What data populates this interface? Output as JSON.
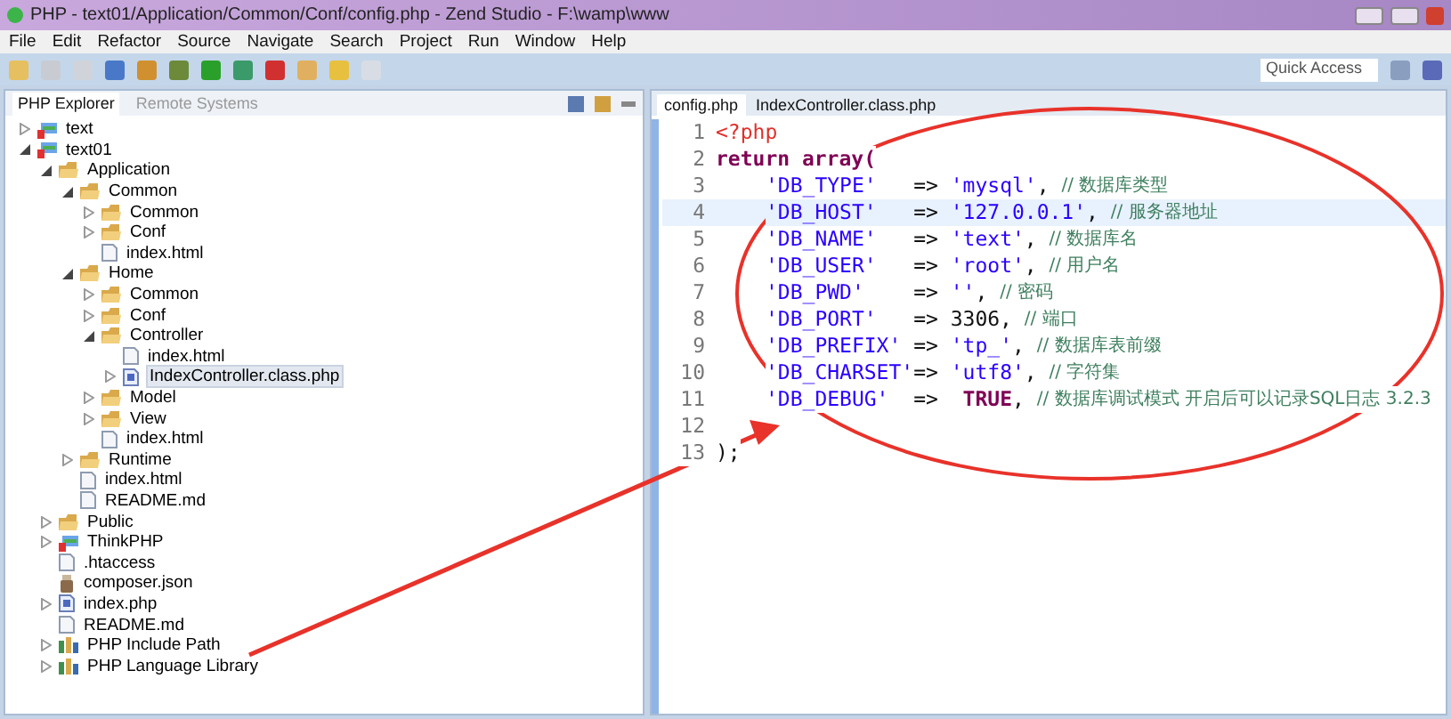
{
  "window": {
    "title": "PHP - text01/Application/Common/Conf/config.php - Zend Studio - F:\\wamp\\www"
  },
  "menu": [
    "File",
    "Edit",
    "Refactor",
    "Source",
    "Navigate",
    "Search",
    "Project",
    "Run",
    "Window",
    "Help"
  ],
  "quick_access": {
    "placeholder": "Quick Access"
  },
  "explorer": {
    "tabs": [
      {
        "label": "PHP Explorer",
        "selected": true
      },
      {
        "label": "Remote Systems",
        "selected": false
      }
    ],
    "tree": [
      {
        "label": "text",
        "kind": "project",
        "expanded": false,
        "selected": false
      },
      {
        "label": "text01",
        "kind": "project",
        "expanded": true,
        "selected": false,
        "children": [
          {
            "label": "Application",
            "kind": "folder",
            "expanded": true,
            "selected": false,
            "children": [
              {
                "label": "Common",
                "kind": "folder",
                "expanded": true,
                "selected": false,
                "children": [
                  {
                    "label": "Common",
                    "kind": "folder",
                    "expanded": false,
                    "selected": false
                  },
                  {
                    "label": "Conf",
                    "kind": "folder",
                    "expanded": false,
                    "selected": false
                  },
                  {
                    "label": "index.html",
                    "kind": "file",
                    "selected": false
                  }
                ]
              },
              {
                "label": "Home",
                "kind": "folder",
                "expanded": true,
                "selected": false,
                "children": [
                  {
                    "label": "Common",
                    "kind": "folder",
                    "expanded": false,
                    "selected": false
                  },
                  {
                    "label": "Conf",
                    "kind": "folder",
                    "expanded": false,
                    "selected": false
                  },
                  {
                    "label": "Controller",
                    "kind": "folder",
                    "expanded": true,
                    "selected": false,
                    "children": [
                      {
                        "label": "index.html",
                        "kind": "file",
                        "selected": false
                      },
                      {
                        "label": "IndexController.class.php",
                        "kind": "php",
                        "expanded": false,
                        "selected": true
                      }
                    ]
                  },
                  {
                    "label": "Model",
                    "kind": "folder",
                    "expanded": false,
                    "selected": false
                  },
                  {
                    "label": "View",
                    "kind": "folder",
                    "expanded": false,
                    "selected": false
                  },
                  {
                    "label": "index.html",
                    "kind": "file",
                    "selected": false
                  }
                ]
              },
              {
                "label": "Runtime",
                "kind": "folder",
                "expanded": false,
                "selected": false
              },
              {
                "label": "index.html",
                "kind": "file",
                "selected": false
              },
              {
                "label": "README.md",
                "kind": "file",
                "selected": false
              }
            ]
          },
          {
            "label": "Public",
            "kind": "folder",
            "expanded": false,
            "selected": false
          },
          {
            "label": "ThinkPHP",
            "kind": "project",
            "expanded": false,
            "selected": false
          },
          {
            "label": ".htaccess",
            "kind": "file",
            "selected": false
          },
          {
            "label": "composer.json",
            "kind": "json",
            "selected": false
          },
          {
            "label": "index.php",
            "kind": "php",
            "expanded": false,
            "selected": false
          },
          {
            "label": "README.md",
            "kind": "file",
            "selected": false
          },
          {
            "label": "PHP Include Path",
            "kind": "library",
            "expanded": false,
            "selected": false
          },
          {
            "label": "PHP Language Library",
            "kind": "library",
            "expanded": false,
            "selected": false
          }
        ]
      }
    ]
  },
  "editor": {
    "tabs": [
      {
        "label": "config.php",
        "selected": true
      },
      {
        "label": "IndexController.class.php",
        "selected": false
      }
    ],
    "lines": [
      {
        "number": "1",
        "current": false,
        "tokens": [
          {
            "kind": "tag",
            "text": "<?php"
          }
        ]
      },
      {
        "number": "2",
        "current": false,
        "tokens": [
          {
            "kind": "keyword",
            "text": "return array("
          }
        ]
      },
      {
        "number": "3",
        "current": false,
        "indented": true,
        "tokens": [
          {
            "kind": "string",
            "text": "'DB_TYPE'   "
          },
          {
            "kind": "plain",
            "text": "=> "
          },
          {
            "kind": "string",
            "text": "'mysql'"
          },
          {
            "kind": "plain",
            "text": ", "
          },
          {
            "kind": "comment",
            "text": "// 数据库类型"
          }
        ]
      },
      {
        "number": "4",
        "current": true,
        "indented": true,
        "tokens": [
          {
            "kind": "string",
            "text": "'DB_HOST'   "
          },
          {
            "kind": "plain",
            "text": "=> "
          },
          {
            "kind": "string",
            "text": "'127.0.0.1'"
          },
          {
            "kind": "plain",
            "text": ", "
          },
          {
            "kind": "comment",
            "text": "// 服务器地址"
          }
        ]
      },
      {
        "number": "5",
        "current": false,
        "indented": true,
        "tokens": [
          {
            "kind": "string",
            "text": "'DB_NAME'   "
          },
          {
            "kind": "plain",
            "text": "=> "
          },
          {
            "kind": "string",
            "text": "'text'"
          },
          {
            "kind": "plain",
            "text": ", "
          },
          {
            "kind": "comment",
            "text": "// 数据库名"
          }
        ]
      },
      {
        "number": "6",
        "current": false,
        "indented": true,
        "tokens": [
          {
            "kind": "string",
            "text": "'DB_USER'   "
          },
          {
            "kind": "plain",
            "text": "=> "
          },
          {
            "kind": "string",
            "text": "'root'"
          },
          {
            "kind": "plain",
            "text": ", "
          },
          {
            "kind": "comment",
            "text": "// 用户名"
          }
        ]
      },
      {
        "number": "7",
        "current": false,
        "indented": true,
        "tokens": [
          {
            "kind": "string",
            "text": "'DB_PWD'    "
          },
          {
            "kind": "plain",
            "text": "=> "
          },
          {
            "kind": "string",
            "text": "''"
          },
          {
            "kind": "plain",
            "text": ", "
          },
          {
            "kind": "comment",
            "text": "// 密码"
          }
        ]
      },
      {
        "number": "8",
        "current": false,
        "indented": true,
        "tokens": [
          {
            "kind": "string",
            "text": "'DB_PORT'   "
          },
          {
            "kind": "plain",
            "text": "=> 3306, "
          },
          {
            "kind": "comment",
            "text": "// 端口"
          }
        ]
      },
      {
        "number": "9",
        "current": false,
        "indented": true,
        "tokens": [
          {
            "kind": "string",
            "text": "'DB_PREFIX' "
          },
          {
            "kind": "plain",
            "text": "=> "
          },
          {
            "kind": "string",
            "text": "'tp_'"
          },
          {
            "kind": "plain",
            "text": ", "
          },
          {
            "kind": "comment",
            "text": "// 数据库表前缀"
          }
        ]
      },
      {
        "number": "10",
        "current": false,
        "indented": true,
        "tokens": [
          {
            "kind": "string",
            "text": "'DB_CHARSET'"
          },
          {
            "kind": "plain",
            "text": "=> "
          },
          {
            "kind": "string",
            "text": "'utf8'"
          },
          {
            "kind": "plain",
            "text": ", "
          },
          {
            "kind": "comment",
            "text": "// 字符集"
          }
        ]
      },
      {
        "number": "11",
        "current": false,
        "indented": true,
        "tokens": [
          {
            "kind": "string",
            "text": "'DB_DEBUG'  "
          },
          {
            "kind": "plain",
            "text": "=>  "
          },
          {
            "kind": "constant",
            "text": "TRUE"
          },
          {
            "kind": "plain",
            "text": ", "
          },
          {
            "kind": "comment",
            "text": "// 数据库调试模式 开启后可以记录SQL日志 3.2.3"
          }
        ]
      },
      {
        "number": "12",
        "current": false
      },
      {
        "number": "13",
        "current": false,
        "tokens": [
          {
            "kind": "plain",
            "text": ");"
          }
        ]
      }
    ]
  }
}
